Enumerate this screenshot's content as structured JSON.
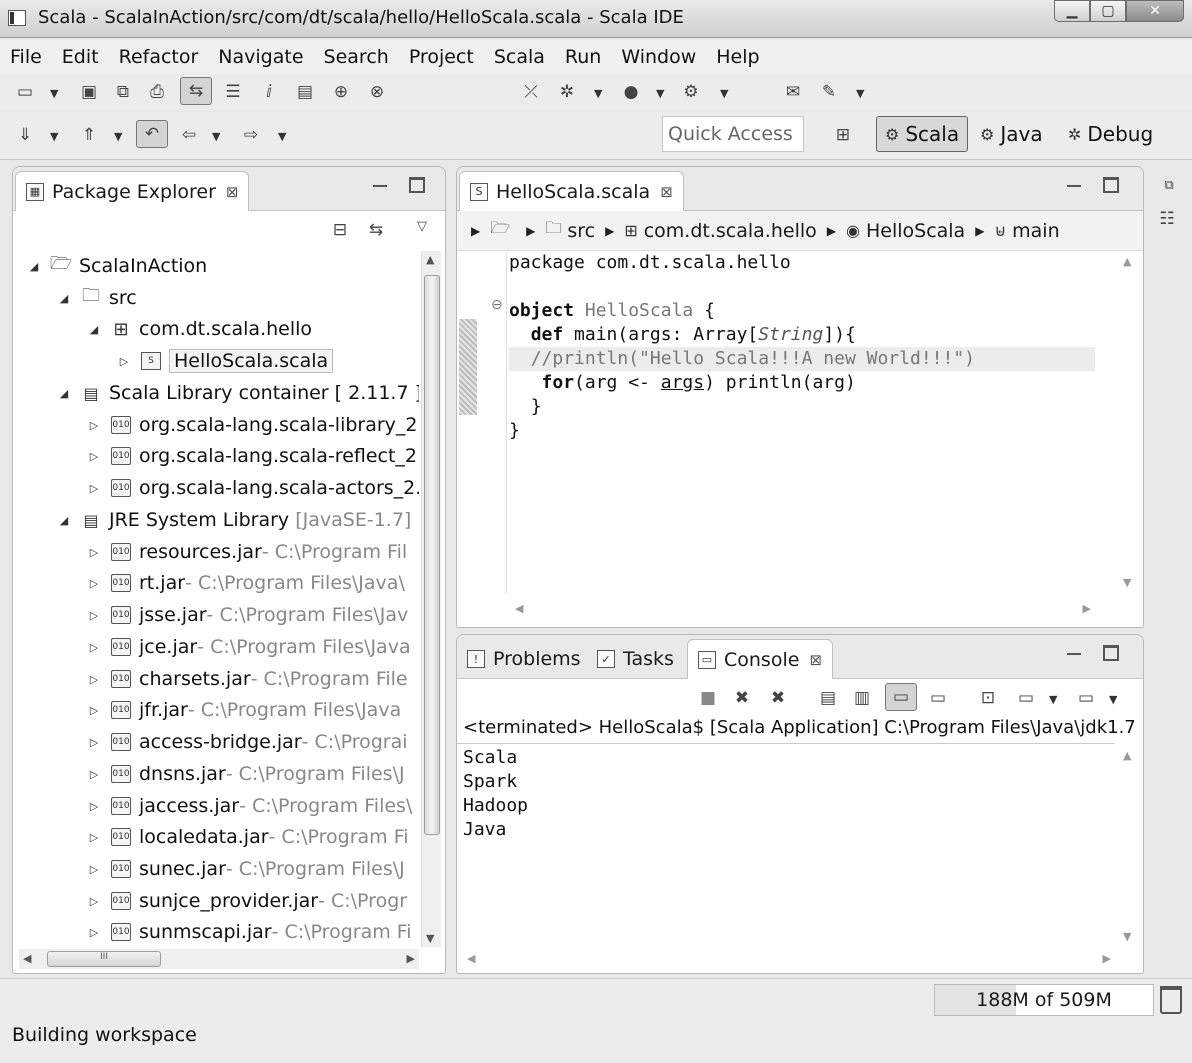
{
  "window": {
    "title": "Scala - ScalaInAction/src/com/dt/scala/hello/HelloScala.scala - Scala IDE"
  },
  "menu": [
    "File",
    "Edit",
    "Refactor",
    "Navigate",
    "Search",
    "Project",
    "Scala",
    "Run",
    "Window",
    "Help"
  ],
  "quick_access": {
    "placeholder": "Quick Access"
  },
  "perspectives": [
    {
      "label": "Scala",
      "icon": "scala-perspective-icon",
      "active": true
    },
    {
      "label": "Java",
      "icon": "java-perspective-icon",
      "active": false
    },
    {
      "label": "Debug",
      "icon": "debug-perspective-icon",
      "active": false
    }
  ],
  "package_explorer": {
    "tab_label": "Package Explorer",
    "project": "ScalaInAction",
    "src": "src",
    "package": "com.dt.scala.hello",
    "file": "HelloScala.scala",
    "scala_lib": {
      "label": "Scala Library container",
      "decoration": "[ 2.11.7 ]"
    },
    "scala_jars": [
      "org.scala-lang.scala-library_2.",
      "org.scala-lang.scala-reflect_2.",
      "org.scala-lang.scala-actors_2."
    ],
    "jre": {
      "label": "JRE System Library",
      "decoration": "[JavaSE-1.7]"
    },
    "jre_jars": [
      {
        "name": "resources.jar",
        "path": " - C:\\Program Fil"
      },
      {
        "name": "rt.jar",
        "path": " - C:\\Program Files\\Java\\"
      },
      {
        "name": "jsse.jar",
        "path": " - C:\\Program Files\\Jav"
      },
      {
        "name": "jce.jar",
        "path": " - C:\\Program Files\\Java"
      },
      {
        "name": "charsets.jar",
        "path": " - C:\\Program File"
      },
      {
        "name": "jfr.jar",
        "path": " - C:\\Program Files\\Java"
      },
      {
        "name": "access-bridge.jar",
        "path": " - C:\\Prograi"
      },
      {
        "name": "dnsns.jar",
        "path": " - C:\\Program Files\\J"
      },
      {
        "name": "jaccess.jar",
        "path": " - C:\\Program Files\\"
      },
      {
        "name": "localedata.jar",
        "path": " - C:\\Program Fi"
      },
      {
        "name": "sunec.jar",
        "path": " - C:\\Program Files\\J"
      },
      {
        "name": "sunjce_provider.jar",
        "path": " - C:\\Progr"
      },
      {
        "name": "sunmscapi.jar",
        "path": " - C:\\Program Fi"
      }
    ]
  },
  "editor": {
    "tab_label": "HelloScala.scala",
    "breadcrumb": [
      "src",
      "com.dt.scala.hello",
      "HelloScala",
      "main"
    ],
    "code": {
      "l1": "package com.dt.scala.hello",
      "l3_kw": "object",
      "l3_name": "HelloScala",
      "l3_rest": " {",
      "l4_kw": "def",
      "l4_a": " main(args: Array[",
      "l4_type": "String",
      "l4_b": "]){",
      "l5": "//println(\"Hello Scala!!!A new World!!!\")",
      "l6_kw": "for",
      "l6_a": "(arg <- ",
      "l6_args": "args",
      "l6_b": ") println(arg)",
      "l7": "}",
      "l8": "}"
    }
  },
  "bottom_tabs": {
    "problems": "Problems",
    "tasks": "Tasks",
    "console": "Console"
  },
  "console": {
    "header": "<terminated> HelloScala$ [Scala Application] C:\\Program Files\\Java\\jdk1.7",
    "output": [
      "Scala",
      "Spark",
      "Hadoop",
      "Java"
    ]
  },
  "status": {
    "heap": "188M of 509M",
    "heap_used_fraction": 0.37,
    "message": "Building workspace"
  }
}
